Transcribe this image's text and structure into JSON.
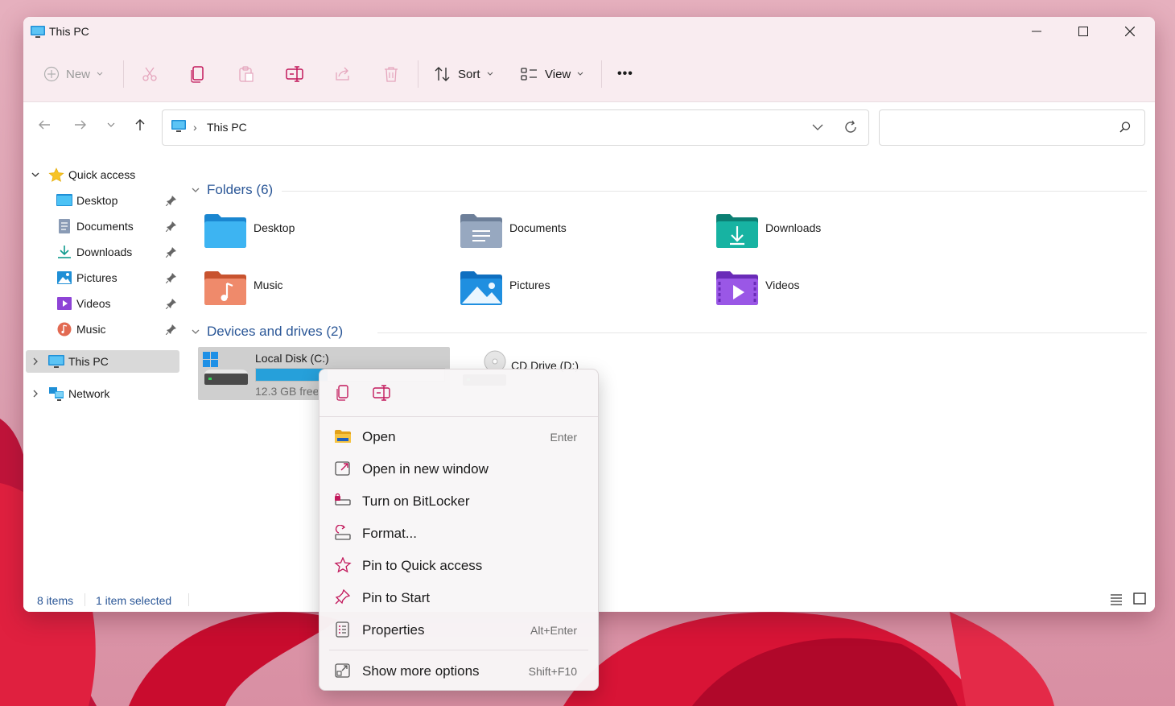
{
  "window": {
    "title": "This PC"
  },
  "toolbar": {
    "new_label": "New",
    "sort_label": "Sort",
    "view_label": "View",
    "more_label": "•••"
  },
  "address": {
    "crumb": "This PC",
    "search_placeholder": ""
  },
  "sidebar": {
    "quick_access": "Quick access",
    "items": [
      {
        "label": "Desktop",
        "icon": "desktop-folder-icon"
      },
      {
        "label": "Documents",
        "icon": "documents-folder-icon"
      },
      {
        "label": "Downloads",
        "icon": "downloads-arrow-icon"
      },
      {
        "label": "Pictures",
        "icon": "pictures-folder-icon"
      },
      {
        "label": "Videos",
        "icon": "videos-folder-icon"
      },
      {
        "label": "Music",
        "icon": "music-folder-icon"
      }
    ],
    "this_pc": "This PC",
    "network": "Network"
  },
  "content": {
    "folders_header": "Folders (6)",
    "folders": [
      {
        "label": "Desktop"
      },
      {
        "label": "Documents"
      },
      {
        "label": "Downloads"
      },
      {
        "label": "Music"
      },
      {
        "label": "Pictures"
      },
      {
        "label": "Videos"
      }
    ],
    "drives_header": "Devices and drives (2)",
    "drives": [
      {
        "label": "Local Disk (C:)",
        "free": "12.3 GB free of 237 GB",
        "used_fraction": 0.38
      },
      {
        "label": "CD Drive (D:)"
      }
    ]
  },
  "status": {
    "items": "8 items",
    "selected": "1 item selected"
  },
  "context_menu": {
    "items": [
      {
        "label": "Open",
        "shortcut": "Enter",
        "icon": "folder-open-icon"
      },
      {
        "label": "Open in new window",
        "shortcut": "",
        "icon": "new-window-icon"
      },
      {
        "label": "Turn on BitLocker",
        "shortcut": "",
        "icon": "bitlocker-icon"
      },
      {
        "label": "Format...",
        "shortcut": "",
        "icon": "format-icon"
      },
      {
        "label": "Pin to Quick access",
        "shortcut": "",
        "icon": "star-icon"
      },
      {
        "label": "Pin to Start",
        "shortcut": "",
        "icon": "pin-icon"
      },
      {
        "label": "Properties",
        "shortcut": "Alt+Enter",
        "icon": "properties-icon"
      },
      {
        "label": "Show more options",
        "shortcut": "Shift+F10",
        "icon": "more-options-icon"
      }
    ]
  },
  "colors": {
    "accent": "#d6005c",
    "link": "#2b5797",
    "titlebar": "#f9ecf0",
    "drive_fill": "#26a0da"
  }
}
